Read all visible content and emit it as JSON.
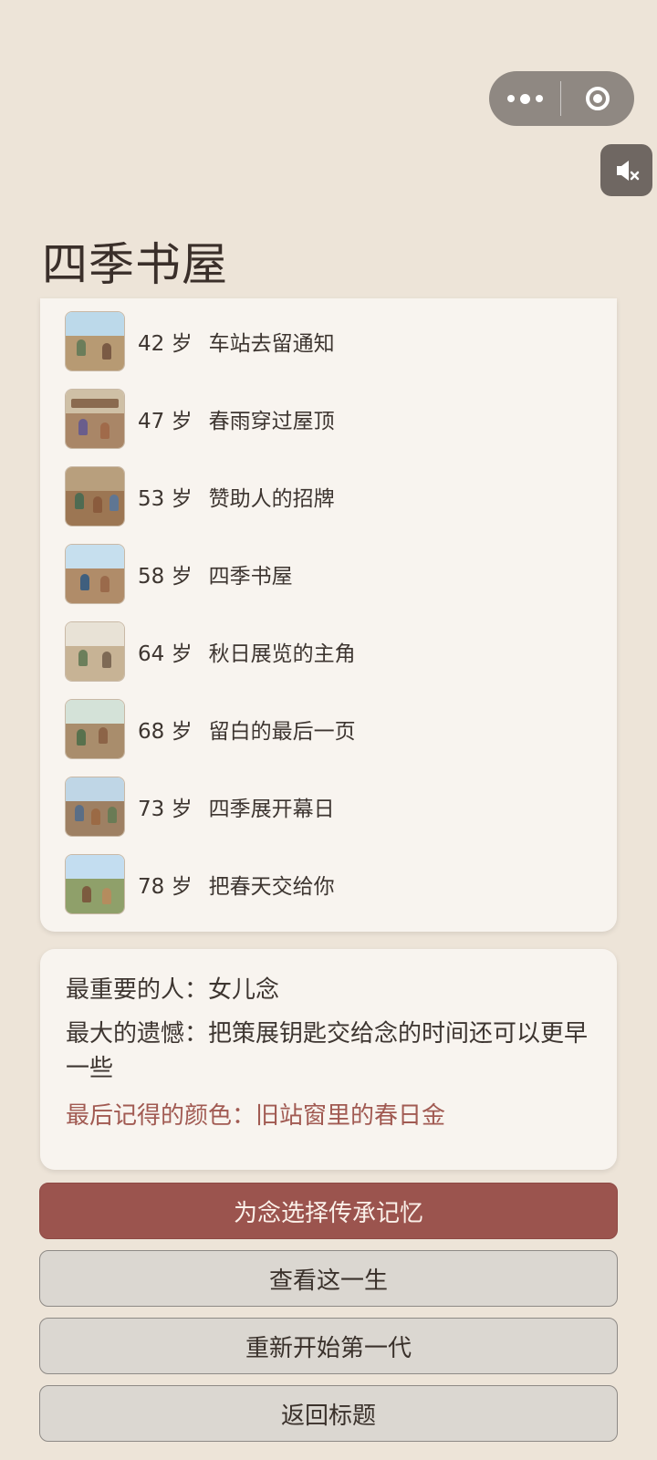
{
  "app": {
    "title": "四季书屋"
  },
  "capsule": {
    "more_icon": "more-dots-icon",
    "close_icon": "target-circle-icon"
  },
  "sound": {
    "icon": "speaker-muted-icon"
  },
  "timeline": {
    "age_unit": "岁",
    "items": [
      {
        "age": "42",
        "event": "车站去留通知"
      },
      {
        "age": "47",
        "event": "春雨穿过屋顶"
      },
      {
        "age": "53",
        "event": "赞助人的招牌"
      },
      {
        "age": "58",
        "event": "四季书屋"
      },
      {
        "age": "64",
        "event": "秋日展览的主角"
      },
      {
        "age": "68",
        "event": "留白的最后一页"
      },
      {
        "age": "73",
        "event": "四季展开幕日"
      },
      {
        "age": "78",
        "event": "把春天交给你"
      }
    ]
  },
  "summary": {
    "important_person": "最重要的人：女儿念",
    "biggest_regret": "最大的遗憾：把策展钥匙交给念的时间还可以更早一些",
    "last_color": "最后记得的颜色：旧站窗里的春日金"
  },
  "buttons": {
    "pass_memory": "为念选择传承记忆",
    "view_life": "查看这一生",
    "restart": "重新开始第一代",
    "back_title": "返回标题"
  },
  "colors": {
    "background": "#ede4d8",
    "card": "#f8f4ef",
    "primary_button": "#9b544e",
    "accent_text": "#a15a52",
    "secondary_button": "#dbd7d1"
  }
}
